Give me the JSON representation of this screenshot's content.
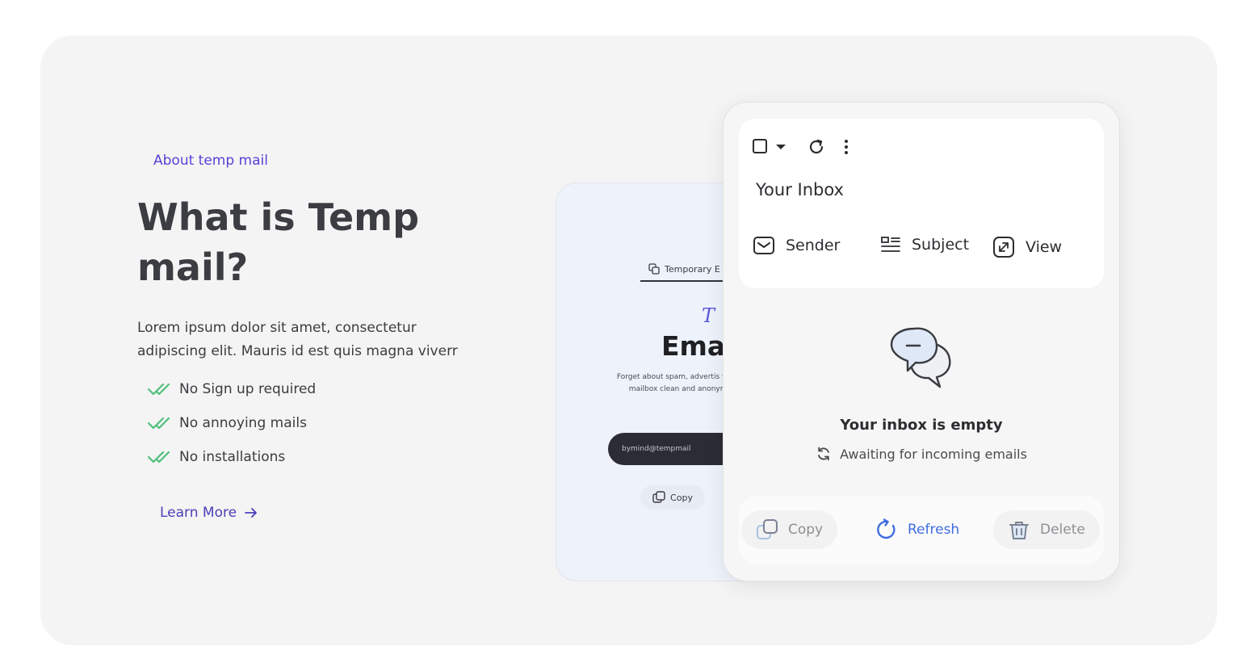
{
  "about": {
    "eyebrow": "About temp mail",
    "headline": "What is Temp mail?",
    "description": "Lorem ipsum dolor sit amet, consectetur adipiscing elit. Mauris id est quis magna viverr",
    "features": [
      "No Sign up required",
      "No annoying mails",
      "No installations"
    ],
    "learn_more": "Learn More"
  },
  "back_card": {
    "tab_label": "Temporary E",
    "handwriting": "T",
    "title": "Emai",
    "text": "Forget about spam, advertis your real mailbox clean and anonymous,",
    "email": "bymind@tempmail",
    "copy_label": "Copy"
  },
  "inbox": {
    "title": "Your Inbox",
    "columns": {
      "sender": "Sender",
      "subject": "Subject",
      "view": "View"
    },
    "empty_title": "Your inbox is empty",
    "empty_sub": "Awaiting for incoming emails",
    "actions": {
      "copy": "Copy",
      "refresh": "Refresh",
      "delete": "Delete"
    }
  },
  "colors": {
    "accent": "#5b3fd6",
    "link": "#4a3fb8",
    "refresh": "#3f6de0",
    "check": "#4fc07a",
    "panel": "#f4f4f4"
  },
  "icons": [
    "check-icon",
    "arrow-right-icon",
    "checkbox-icon",
    "caret-down-icon",
    "reload-icon",
    "more-vert-icon",
    "envelope-icon",
    "list-icon",
    "expand-icon",
    "chat-bubbles-icon",
    "sync-icon",
    "copy-icon",
    "refresh-icon",
    "trash-icon"
  ]
}
